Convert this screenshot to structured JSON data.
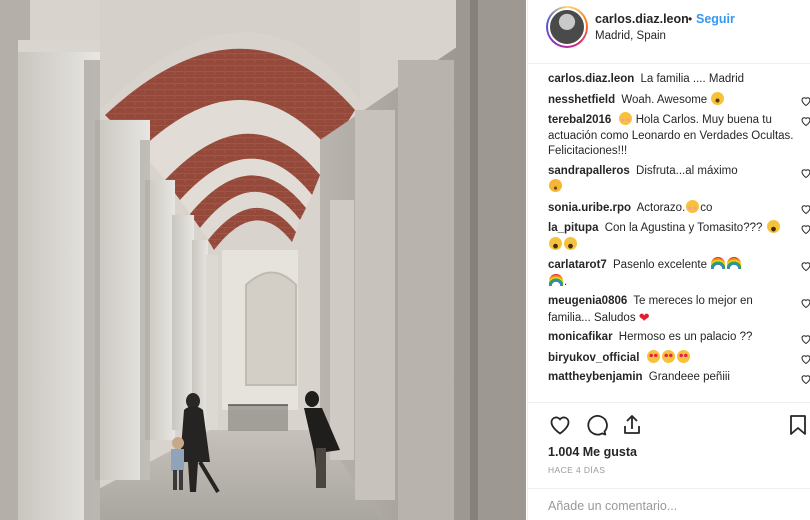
{
  "post": {
    "username": "carlos.diaz.leon",
    "separator": "•",
    "follow_label": "Seguir",
    "location": "Madrid, Spain"
  },
  "comments": [
    {
      "user": "carlos.diaz.leon",
      "text": "La familia .... Madrid",
      "likeable": false
    },
    {
      "user": "nesshetfield",
      "text": "Woah. Awesome",
      "likeable": true,
      "emoji": [
        "wow"
      ]
    },
    {
      "user": "terebal2016",
      "text": "Hola Carlos. Muy buena tu actuación como Leonardo en Verdades Ocultas. Felicitaciones!!!",
      "likeable": true,
      "lead_emoji": [
        "blush"
      ]
    },
    {
      "user": "sandrapalleros",
      "text": "Disfruta...al máximo",
      "likeable": true,
      "emoji": [
        "smile"
      ]
    },
    {
      "user": "sonia.uribe.rpo",
      "text": "Actorazo.",
      "tail": "co",
      "likeable": true,
      "emoji": [
        "blush"
      ]
    },
    {
      "user": "la_pitupa",
      "text": "Con la Agustina y Tomasito???",
      "likeable": true,
      "emoji": [
        "laugh",
        "laugh",
        "laugh"
      ]
    },
    {
      "user": "carlatarot7",
      "text": "Pasenlo excelente",
      "tail": ".",
      "likeable": true,
      "emoji": [
        "rainbow",
        "rainbow",
        "rainbow"
      ]
    },
    {
      "user": "meugenia0806",
      "text": "Te mereces lo mejor en familia... Saludos",
      "likeable": true,
      "emoji": [
        "red-heart"
      ]
    },
    {
      "user": "monicafikar",
      "text": "Hermoso es un palacio ??",
      "likeable": true
    },
    {
      "user": "biryukov_official",
      "text": "",
      "likeable": true,
      "emoji": [
        "hearts",
        "hearts",
        "hearts"
      ]
    },
    {
      "user": "mattheybenjamin",
      "text": "Grandeee peñiii",
      "likeable": true
    }
  ],
  "actions": {
    "like_icon": "heart-outline-icon",
    "comment_icon": "comment-bubble-icon",
    "share_icon": "share-upload-icon",
    "save_icon": "bookmark-icon"
  },
  "likes_text": "1.004 Me gusta",
  "time_text": "HACE 4 DÍAS",
  "add_comment": {
    "placeholder": "Añade un comentario..."
  },
  "colors": {
    "accent": "#3897f0",
    "text": "#262626",
    "muted": "#999999",
    "border": "#efefef"
  }
}
